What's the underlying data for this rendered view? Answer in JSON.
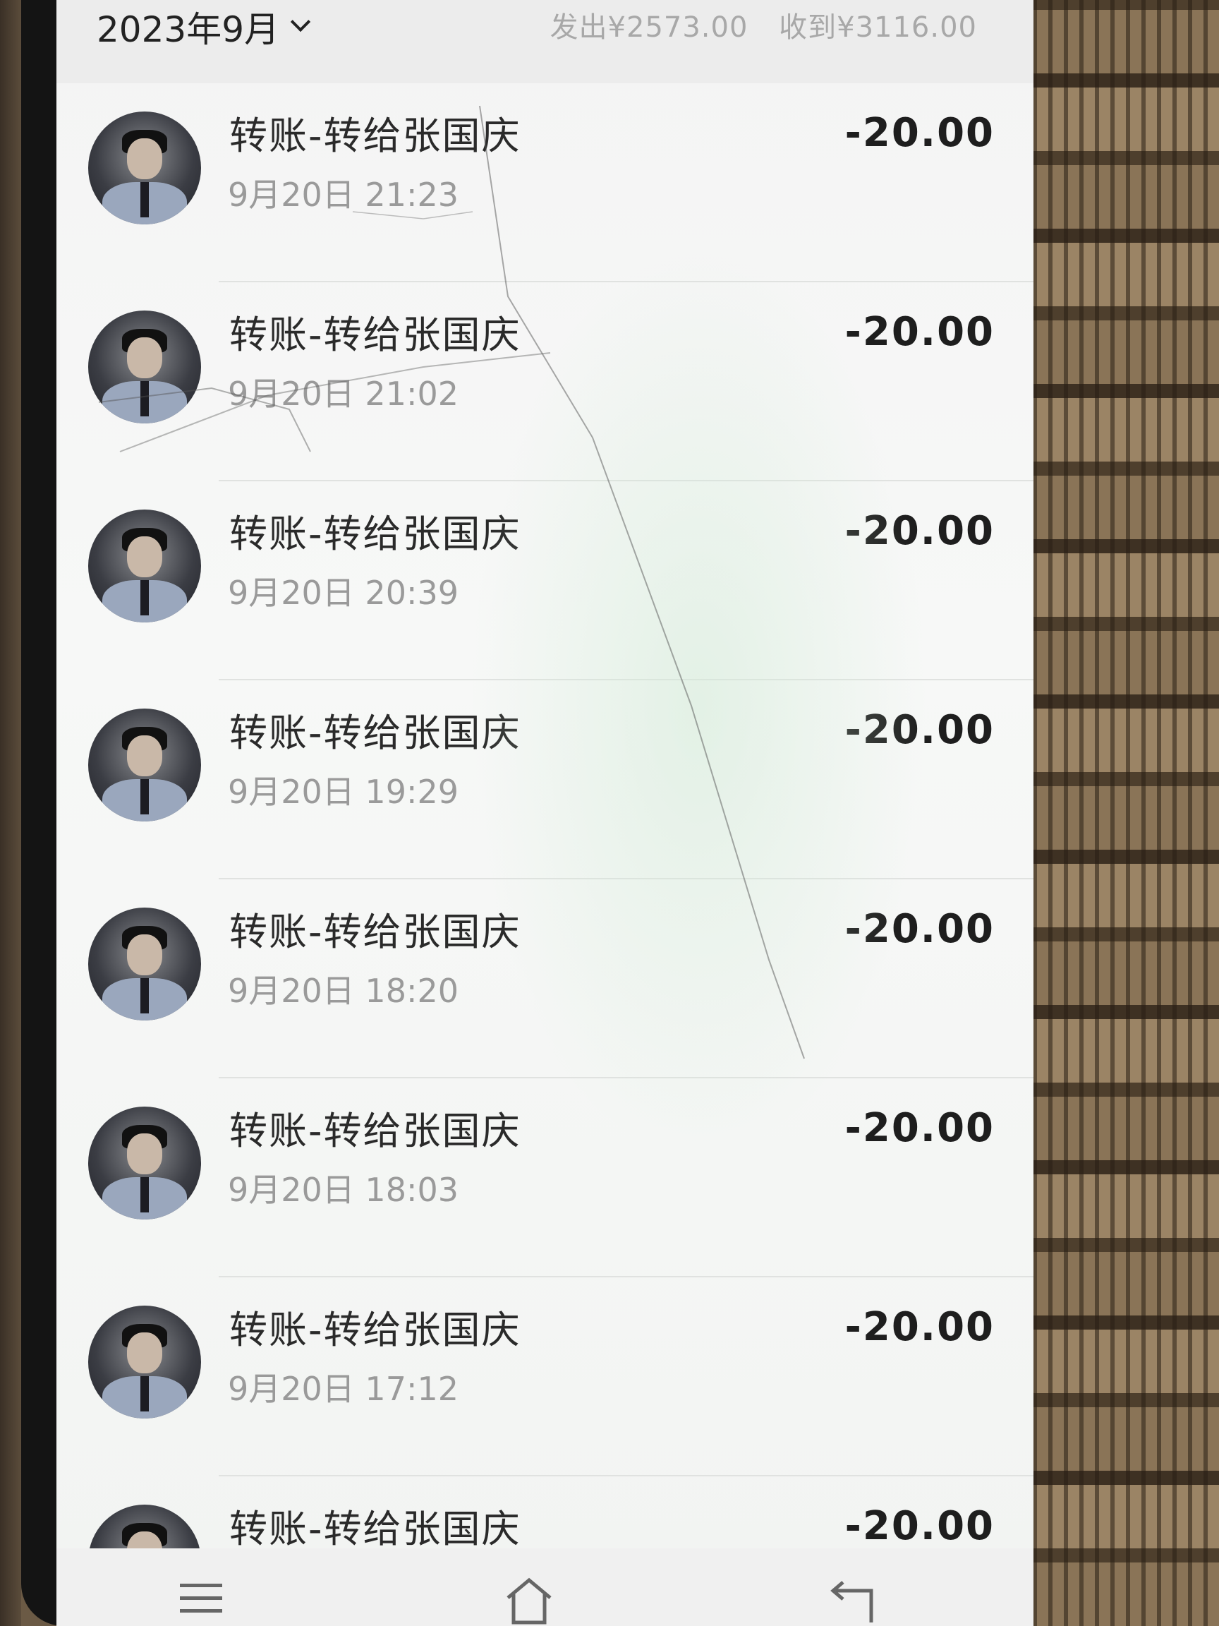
{
  "header": {
    "month_label": "2023年9月",
    "sent_label": "发出¥2573.00",
    "received_label": "收到¥3116.00"
  },
  "transactions": [
    {
      "title": "转账-转给张国庆",
      "time": "9月20日 21:23",
      "amount": "-20.00"
    },
    {
      "title": "转账-转给张国庆",
      "time": "9月20日 21:02",
      "amount": "-20.00"
    },
    {
      "title": "转账-转给张国庆",
      "time": "9月20日 20:39",
      "amount": "-20.00"
    },
    {
      "title": "转账-转给张国庆",
      "time": "9月20日 19:29",
      "amount": "-20.00"
    },
    {
      "title": "转账-转给张国庆",
      "time": "9月20日 18:20",
      "amount": "-20.00"
    },
    {
      "title": "转账-转给张国庆",
      "time": "9月20日 18:03",
      "amount": "-20.00"
    },
    {
      "title": "转账-转给张国庆",
      "time": "9月20日 17:12",
      "amount": "-20.00"
    },
    {
      "title": "转账-转给张国庆",
      "time": "",
      "amount": "-20.00"
    }
  ],
  "navbar": {
    "icons": [
      "menu-icon",
      "home-icon",
      "back-icon"
    ]
  }
}
